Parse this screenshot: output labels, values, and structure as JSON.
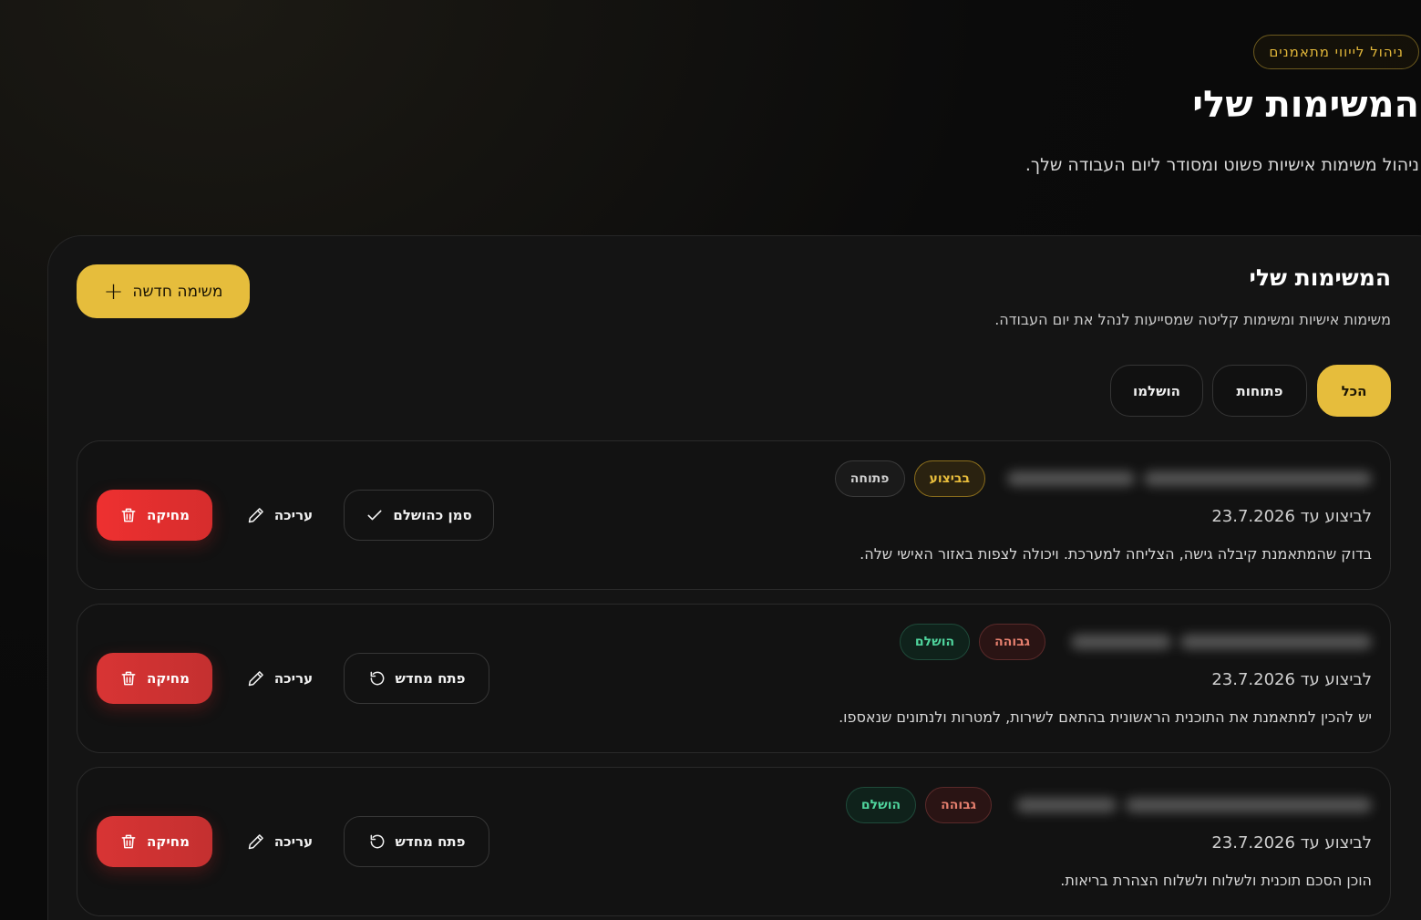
{
  "hero": {
    "badge": "ניהול לייווי מתאמנים",
    "title": "המשימות שלי",
    "subtitle": "ניהול משימות אישיות פשוט ומסודר ליום העבודה שלך."
  },
  "panel": {
    "title": "המשימות שלי",
    "subtitle": "משימות אישיות ומשימות קליטה שמסייעות לנהל את יום העבודה.",
    "new_task_label": "משימה חדשה"
  },
  "filters": {
    "all": "הכל",
    "open": "פתוחות",
    "done": "הושלמו",
    "active": "all"
  },
  "tasks": [
    {
      "tags": [
        "בביצוע",
        "פתוחה"
      ],
      "due": "לביצוע עד 23.7.2026",
      "description": "בדוק שהמתאמנת קיבלה גישה, הצליחה למערכת. ויכולה לצפות באזור האישי שלה.",
      "primary_action": "סמן כהושלם",
      "edit": "עריכה",
      "delete": "מחיקה"
    },
    {
      "tags": [
        "גבוהה",
        "הושלם"
      ],
      "due": "לביצוע עד 23.7.2026",
      "description": "יש להכין למתאמנת את התוכנית הראשונית בהתאם לשירות, למטרות ולנתונים שנאספו.",
      "primary_action": "פתח מחדש",
      "edit": "עריכה",
      "delete": "מחיקה"
    },
    {
      "tags": [
        "גבוהה",
        "הושלם"
      ],
      "due": "לביצוע עד 23.7.2026",
      "description": "הוכן הסכם תוכנית ולשלוח ולשלוח הצהרת בריאות.",
      "primary_action": "פתח מחדש",
      "edit": "עריכה",
      "delete": "מחיקה"
    }
  ],
  "colors": {
    "accent": "#e6bd3c",
    "danger": "#e53131",
    "success": "#4fd39c",
    "high": "#e57f6e"
  }
}
